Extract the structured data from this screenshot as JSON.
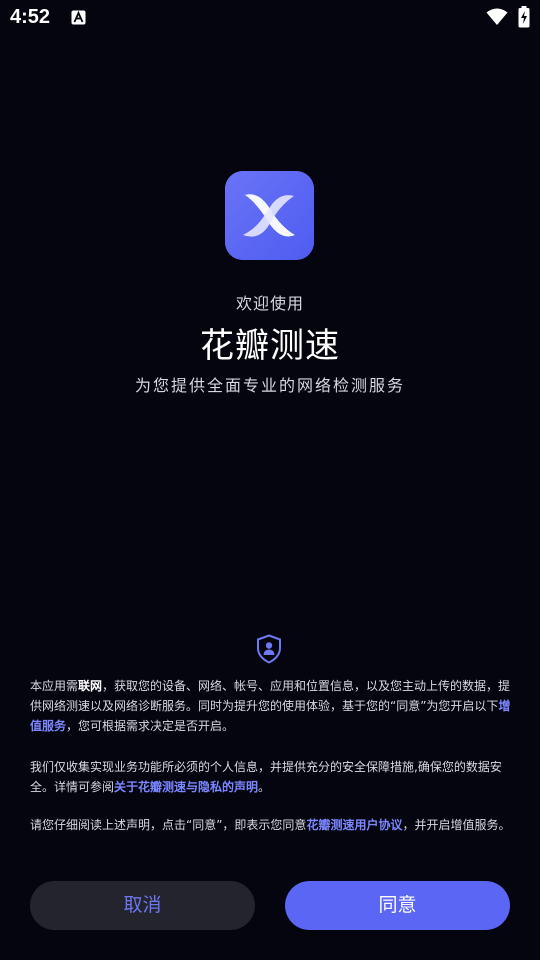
{
  "status_bar": {
    "time": "4:52",
    "icons": [
      "a-notification-icon",
      "wifi-icon",
      "battery-charging-icon"
    ]
  },
  "splash": {
    "logo_icon": "app-logo-x-icon",
    "welcome": "欢迎使用",
    "app_name": "花瓣测速",
    "tagline": "为您提供全面专业的网络检测服务"
  },
  "privacy": {
    "icon": "shield-user-icon",
    "p1_pre": "本应用需",
    "p1_bold": "联网",
    "p1_mid": "，获取您的设备、网络、帐号、应用和位置信息，以及您主动上传的数据，提供网络测速以及网络诊断服务。同时为提升您的使用体验，基于您的“同意”为您开启以下",
    "p1_link": "增值服务",
    "p1_post": "，您可根据需求决定是否开启。",
    "p2_pre": "我们仅收集实现业务功能所必须的个人信息，并提供充分的安全保障措施,确保您的数据安全。详情可参阅",
    "p2_link": "关于花瓣测速与隐私的声明",
    "p2_post": "。",
    "p3_pre": "请您仔细阅读上述声明，点击“同意”，即表示您同意",
    "p3_link": "花瓣测速用户协议",
    "p3_post": "，并开启增值服务。"
  },
  "buttons": {
    "cancel": "取消",
    "agree": "同意"
  },
  "colors": {
    "background": "#05050f",
    "accent": "#5b67f4",
    "link": "#7b86ff",
    "cancel_bg": "#23242e"
  }
}
